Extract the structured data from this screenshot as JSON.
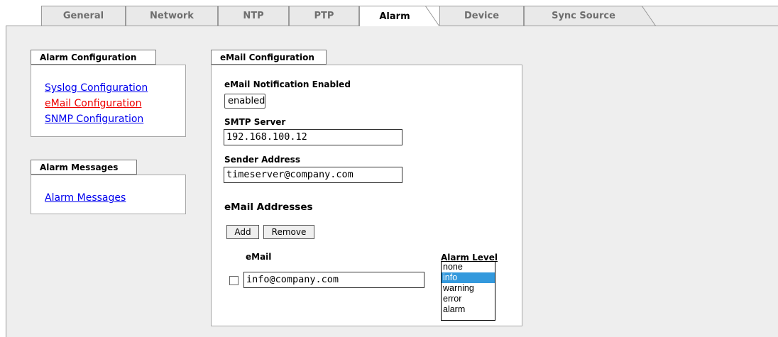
{
  "tabs": [
    {
      "label": "General",
      "active": false
    },
    {
      "label": "Network",
      "active": false
    },
    {
      "label": "NTP",
      "active": false
    },
    {
      "label": "PTP",
      "active": false
    },
    {
      "label": "Alarm",
      "active": true
    },
    {
      "label": "Device",
      "active": false
    },
    {
      "label": "Sync Source",
      "active": false
    }
  ],
  "sidebar": {
    "alarm_config": {
      "title": "Alarm Configuration",
      "links": [
        {
          "label": "Syslog Configuration",
          "current": false
        },
        {
          "label": "eMail Configuration",
          "current": true
        },
        {
          "label": "SNMP Configuration",
          "current": false
        }
      ]
    },
    "alarm_messages": {
      "title": "Alarm Messages",
      "links": [
        {
          "label": "Alarm Messages",
          "current": false
        }
      ]
    }
  },
  "email_config": {
    "title": "eMail Configuration",
    "notification_label": "eMail Notification Enabled",
    "notification_value": "enabled",
    "smtp_label": "SMTP Server",
    "smtp_value": "192.168.100.12",
    "sender_label": "Sender Address",
    "sender_value": "timeserver@company.com",
    "addresses_heading": "eMail Addresses",
    "add_button": "Add",
    "remove_button": "Remove",
    "col_email": "eMail",
    "col_alarm_level": "Alarm Level",
    "rows": [
      {
        "email": "info@company.com",
        "checked": false
      }
    ],
    "alarm_levels": [
      "none",
      "info",
      "warning",
      "error",
      "alarm"
    ],
    "selected_level": "info"
  },
  "colors": {
    "link": "#0000ee",
    "current_link": "#ee0000",
    "selected_option": "#3399dd",
    "background": "#eeeeee"
  }
}
